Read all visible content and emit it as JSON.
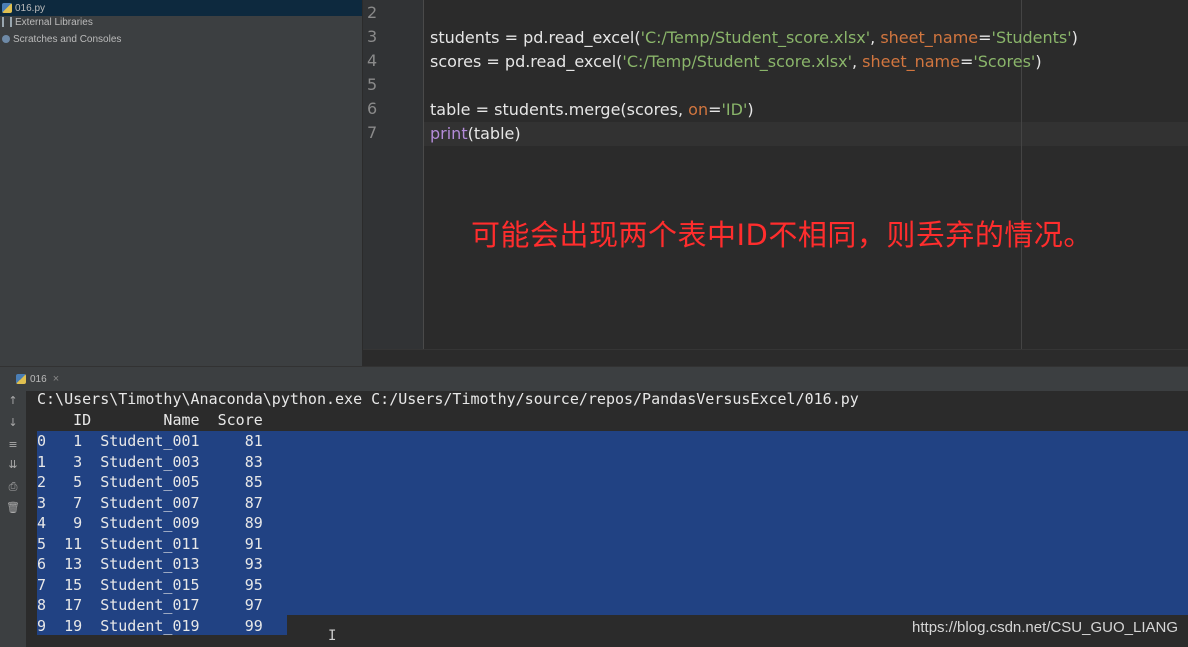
{
  "project_tree": {
    "items": [
      {
        "label": "016.py",
        "icon": "python-file-icon"
      },
      {
        "label": "External Libraries",
        "icon": "library-icon"
      },
      {
        "label": "Scratches and Consoles",
        "icon": "scratch-icon"
      }
    ]
  },
  "editor": {
    "line_numbers": [
      "2",
      "3",
      "4",
      "5",
      "6",
      "7"
    ],
    "lines": [
      [],
      [
        {
          "t": "students = pd.read_excel(",
          "c": "k-op"
        },
        {
          "t": "'C:/Temp/Student_score.xlsx'",
          "c": "k-str"
        },
        {
          "t": ", ",
          "c": "k-op"
        },
        {
          "t": "sheet_name",
          "c": "k-kw"
        },
        {
          "t": "=",
          "c": "k-op"
        },
        {
          "t": "'Students'",
          "c": "k-str"
        },
        {
          "t": ")",
          "c": "k-op"
        }
      ],
      [
        {
          "t": "scores = pd.read_excel(",
          "c": "k-op"
        },
        {
          "t": "'C:/Temp/Student_score.xlsx'",
          "c": "k-str"
        },
        {
          "t": ", ",
          "c": "k-op"
        },
        {
          "t": "sheet_name",
          "c": "k-kw"
        },
        {
          "t": "=",
          "c": "k-op"
        },
        {
          "t": "'Scores'",
          "c": "k-str"
        },
        {
          "t": ")",
          "c": "k-op"
        }
      ],
      [],
      [
        {
          "t": "table = students.merge(scores, ",
          "c": "k-op"
        },
        {
          "t": "on",
          "c": "k-kw"
        },
        {
          "t": "=",
          "c": "k-op"
        },
        {
          "t": "'ID'",
          "c": "k-str"
        },
        {
          "t": ")",
          "c": "k-op"
        }
      ],
      [
        {
          "t": "print",
          "c": "k-bi"
        },
        {
          "t": "(table)",
          "c": "k-op"
        }
      ]
    ],
    "annotation": "可能会出现两个表中ID不相同，则丢弃的情况。"
  },
  "run_panel": {
    "tab_label": "016",
    "tab_close": "×",
    "toolbar_icons": [
      "up-arrow-icon",
      "down-arrow-icon",
      "wrap-icon",
      "scroll-to-end-icon",
      "print-icon",
      "trash-icon"
    ]
  },
  "console": {
    "command": "C:\\Users\\Timothy\\Anaconda\\python.exe C:/Users/Timothy/source/repos/PandasVersusExcel/016.py",
    "header": "    ID        Name  Score",
    "rows": [
      "0   1  Student_001     81",
      "1   3  Student_003     83",
      "2   5  Student_005     85",
      "3   7  Student_007     87",
      "4   9  Student_009     89",
      "5  11  Student_011     91",
      "6  13  Student_013     93",
      "7  15  Student_015     95",
      "8  17  Student_017     97",
      "9  19  Student_019     99"
    ]
  },
  "watermark": "https://blog.csdn.net/CSU_GUO_LIANG",
  "text_cursor": "I"
}
